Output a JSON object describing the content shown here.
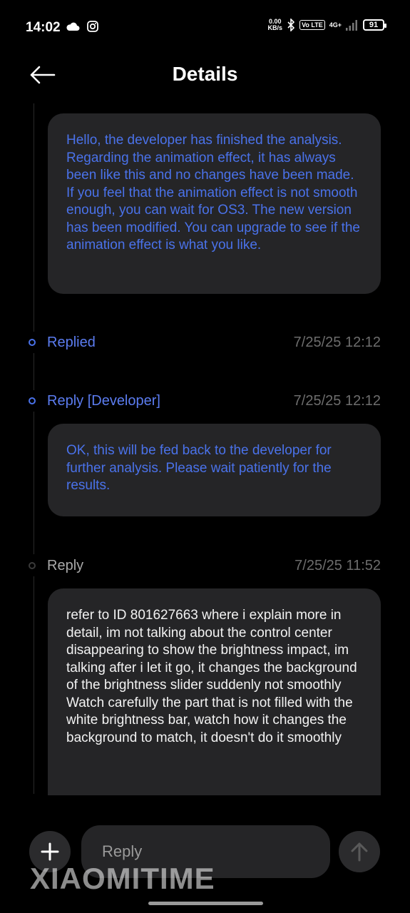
{
  "status_bar": {
    "time": "14:02",
    "net_speed_value": "0.00",
    "net_speed_unit": "KB/s",
    "volte": "Vo LTE",
    "network": "4G+",
    "battery": "91"
  },
  "header": {
    "title": "Details"
  },
  "messages": [
    {
      "text": "Hello, the developer has finished the analysis. Regarding the animation effect, it has always been like this and no changes have been made. If you feel that the animation effect is not smooth enough, you can wait for OS3. The new version has been modified. You can upgrade to see if the animation effect is what you like."
    },
    {
      "label": "Replied",
      "time": "7/25/25 12:12"
    },
    {
      "label": "Reply [Developer]",
      "time": "7/25/25 12:12",
      "text": "OK, this will be fed back to the developer for further analysis. Please wait patiently for the results."
    },
    {
      "label": "Reply",
      "time": "7/25/25 11:52",
      "text": "refer to ID 801627663 where i explain more in detail, im not talking about the control center disappearing to show the brightness impact, im talking after i let it go, it changes the background of the brightness slider suddenly not smoothly Watch carefully the part that is not filled with the white brightness bar, watch how it changes the background to match, it doesn't do it smoothly"
    }
  ],
  "composer": {
    "placeholder": "Reply"
  },
  "watermark": "XIAOMITIME",
  "colors": {
    "accent": "#4a72ea",
    "bubble": "#252527",
    "background": "#000000"
  },
  "icons": [
    "cloud-icon",
    "instagram-icon",
    "bluetooth-icon",
    "signal-icon",
    "battery-icon",
    "back-arrow-icon",
    "plus-icon",
    "send-arrow-icon"
  ]
}
